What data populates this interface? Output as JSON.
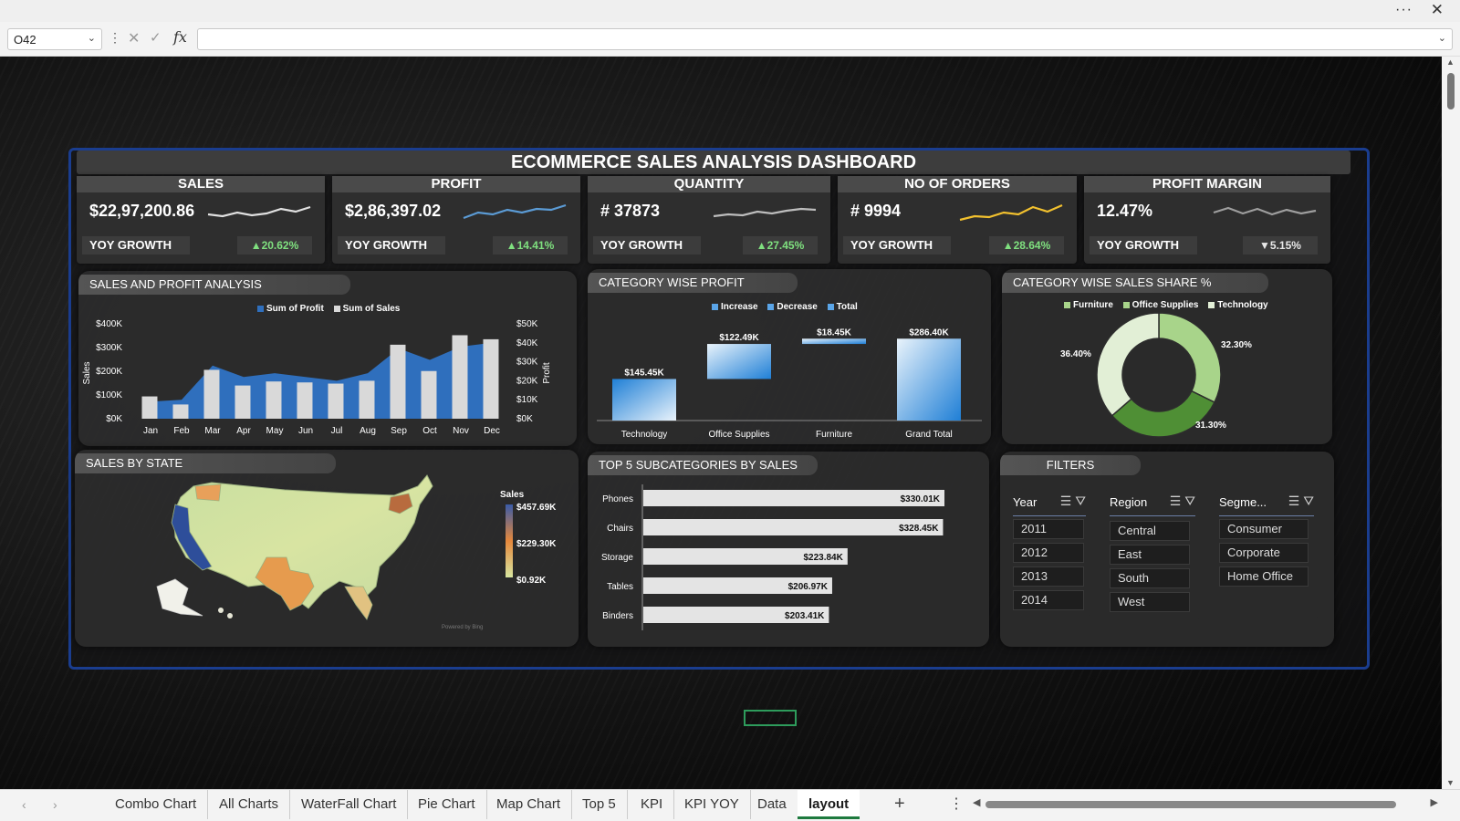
{
  "window": {
    "more_label": "···",
    "close_label": "✕"
  },
  "formula_bar": {
    "name_box": "O42",
    "fx_label": "fx",
    "formula": ""
  },
  "dashboard": {
    "title": "ECOMMERCE SALES ANALYSIS DASHBOARD"
  },
  "kpis": [
    {
      "label": "SALES",
      "value": "$22,97,200.86",
      "yoy_label": "YOY GROWTH",
      "growth": "▲20.62%",
      "trend": "up",
      "spark_color": "#e0e0e0"
    },
    {
      "label": "PROFIT",
      "value": "$2,86,397.02",
      "yoy_label": "YOY GROWTH",
      "growth": "▲14.41%",
      "trend": "up",
      "spark_color": "#5b9bd5"
    },
    {
      "label": "QUANTITY",
      "value": "# 37873",
      "yoy_label": "YOY GROWTH",
      "growth": "▲27.45%",
      "trend": "up",
      "spark_color": "#bdbdbd"
    },
    {
      "label": "NO OF ORDERS",
      "value": "# 9994",
      "yoy_label": "YOY GROWTH",
      "growth": "▲28.64%",
      "trend": "up",
      "spark_color": "#f2c12e"
    },
    {
      "label": "PROFIT MARGIN",
      "value": "12.47%",
      "yoy_label": "YOY GROWTH",
      "growth": "▼5.15%",
      "trend": "down",
      "spark_color": "#9e9e9e"
    }
  ],
  "sales_profit": {
    "title": "SALES AND PROFIT ANALYSIS",
    "legend": [
      "Sum of Profit",
      "Sum of Sales"
    ],
    "colors": {
      "profit": "#2f6fbd",
      "sales": "#d9d9d9"
    }
  },
  "category_profit": {
    "title": "CATEGORY WISE PROFIT",
    "legend": [
      "Increase",
      "Decrease",
      "Total"
    ]
  },
  "category_share": {
    "title": "CATEGORY WISE SALES SHARE %",
    "legend": [
      "Furniture",
      "Office Supplies",
      "Technology"
    ]
  },
  "state_map": {
    "title": "SALES BY STATE",
    "legend_title": "Sales",
    "legend_values": [
      "$457.69K",
      "$229.30K",
      "$0.92K"
    ],
    "watermark": "Powered by Bing"
  },
  "top5": {
    "title": "TOP 5 SUBCATEGORIES BY SALES"
  },
  "filters": {
    "title": "FILTERS",
    "slicers": [
      {
        "name": "Year",
        "items": [
          "2011",
          "2012",
          "2013",
          "2014"
        ]
      },
      {
        "name": "Region",
        "items": [
          "Central",
          "East",
          "South",
          "West"
        ]
      },
      {
        "name": "Segme...",
        "items": [
          "Consumer",
          "Corporate",
          "Home Office"
        ]
      }
    ]
  },
  "chart_data": [
    {
      "type": "bar",
      "title": "SALES AND PROFIT ANALYSIS",
      "categories": [
        "Jan",
        "Feb",
        "Mar",
        "Apr",
        "May",
        "Jun",
        "Jul",
        "Aug",
        "Sep",
        "Oct",
        "Nov",
        "Dec"
      ],
      "series": [
        {
          "name": "Sum of Sales",
          "axis": "left",
          "values": [
            94000,
            60000,
            206000,
            140000,
            157000,
            153000,
            148000,
            160000,
            312000,
            201000,
            352000,
            335000
          ]
        },
        {
          "name": "Sum of Profit",
          "axis": "right",
          "values": [
            9000,
            10000,
            28000,
            22000,
            24000,
            22000,
            20000,
            24000,
            37000,
            31000,
            38000,
            40000
          ]
        }
      ],
      "ylabel": "Sales",
      "ylabel2": "Profit",
      "yticks": [
        "$0K",
        "$100K",
        "$200K",
        "$300K",
        "$400K"
      ],
      "yticks2": [
        "$0K",
        "$10K",
        "$20K",
        "$30K",
        "$40K",
        "$50K"
      ],
      "ylim": [
        0,
        400000
      ],
      "ylim2": [
        0,
        50000
      ]
    },
    {
      "type": "bar",
      "title": "CATEGORY WISE PROFIT",
      "categories": [
        "Technology",
        "Office Supplies",
        "Furniture",
        "Grand Total"
      ],
      "values": [
        145450,
        122490,
        18450,
        286400
      ],
      "labels": [
        "$145.45K",
        "$122.49K",
        "$18.45K",
        "$286.40K"
      ],
      "kinds": [
        "Increase",
        "Increase",
        "Increase",
        "Total"
      ]
    },
    {
      "type": "pie",
      "title": "CATEGORY WISE SALES SHARE %",
      "categories": [
        "Furniture",
        "Office Supplies",
        "Technology"
      ],
      "values": [
        32.3,
        31.3,
        36.4
      ],
      "labels": [
        "32.30%",
        "31.30%",
        "36.40%"
      ],
      "colors": [
        "#a8d48a",
        "#4f8f35",
        "#e2efd6"
      ]
    },
    {
      "type": "bar",
      "title": "TOP 5 SUBCATEGORIES BY SALES",
      "categories": [
        "Phones",
        "Chairs",
        "Storage",
        "Tables",
        "Binders"
      ],
      "values": [
        330010,
        328450,
        223840,
        206970,
        203410
      ],
      "labels": [
        "$330.01K",
        "$328.45K",
        "$223.84K",
        "$206.97K",
        "$203.41K"
      ]
    }
  ],
  "sheet_tabs": [
    "Combo Chart",
    "All Charts",
    "WaterFall Chart",
    "Pie Chart",
    "Map Chart",
    "Top 5",
    "KPI",
    "KPI YOY",
    "Data",
    "layout"
  ],
  "active_tab": "layout",
  "add_sheet_label": "+",
  "tabs_more_label": "⋮"
}
